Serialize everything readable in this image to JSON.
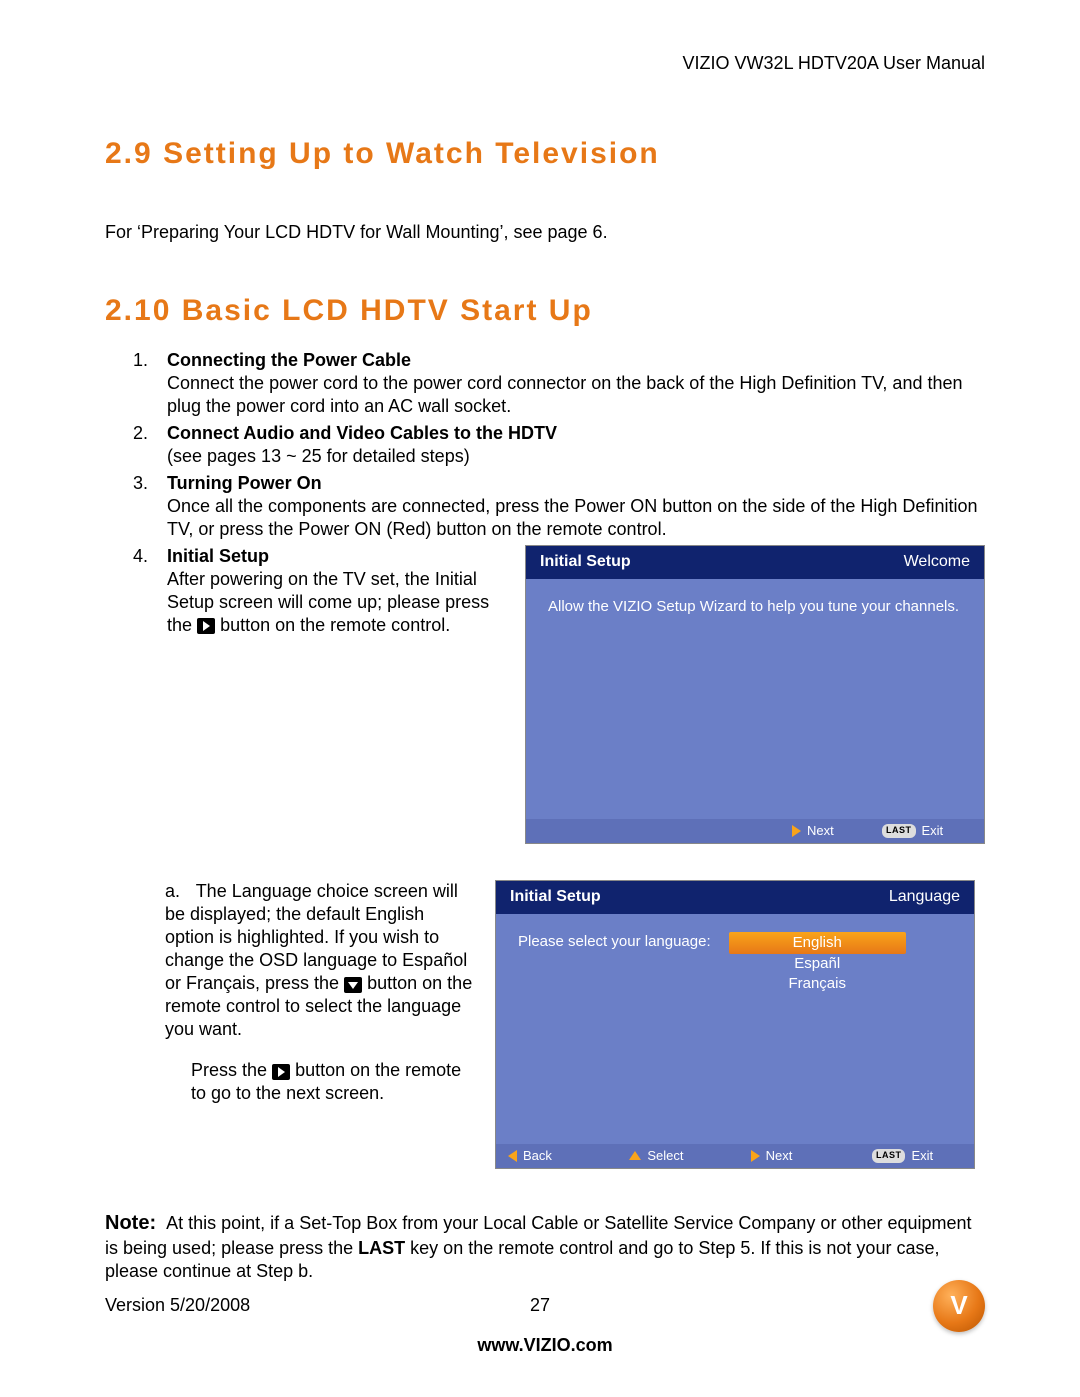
{
  "header": {
    "doc_title": "VIZIO VW32L HDTV20A User Manual"
  },
  "sec29": {
    "num": "2.9",
    "title": "Setting Up to Watch Television",
    "body": "For ‘Preparing Your LCD HDTV for Wall Mounting’, see page 6."
  },
  "sec210": {
    "num": "2.10",
    "title": "Basic LCD HDTV Start Up",
    "items": {
      "i1": {
        "head": "Connecting the Power Cable",
        "body": "Connect the power cord to the power cord connector on the back of the High Definition TV, and then plug the power cord into an AC wall socket."
      },
      "i2": {
        "head": "Connect Audio and Video Cables to the HDTV",
        "body": "(see pages 13 ~ 25 for detailed steps)"
      },
      "i3": {
        "head": "Turning Power On",
        "body": "Once all the components are connected, press the Power ON button on the side of the High Definition TV, or press the Power ON (Red) button on the remote control."
      },
      "i4": {
        "head": "Initial Setup",
        "body_a": "After powering on the TV set, the Initial Setup screen will come up; please press the",
        "body_b": "button on the remote control."
      }
    },
    "sub_a": {
      "label": "a.",
      "body_a": "The Language choice screen will be displayed; the default English option is highlighted.  If you wish to change the OSD language to Español or Français, press the",
      "body_b": "button on the remote control to select the language you want.",
      "body_c": "Press the",
      "body_d": "button on the remote to go to the next screen."
    }
  },
  "screens": {
    "s1": {
      "title_l": "Initial  Setup",
      "title_r": "Welcome",
      "body": "Allow the VIZIO Setup Wizard to help you tune your channels.",
      "foot_next": "Next",
      "foot_exit": "Exit",
      "foot_last": "LAST"
    },
    "s2": {
      "title_l": "Initial  Setup",
      "title_r": "Language",
      "prompt": "Please select your language:",
      "opts": {
        "o1": "English",
        "o2": "Españl",
        "o3": "Français"
      },
      "foot_back": "Back",
      "foot_select": "Select",
      "foot_next": "Next",
      "foot_exit": "Exit",
      "foot_last": "LAST"
    }
  },
  "note": {
    "label": "Note:",
    "body_a": "At this point, if a Set-Top Box from your Local Cable or Satellite Service Company or other equipment is being used; please press the ",
    "bold": "LAST",
    "body_b": " key on the remote control and go to Step 5. If this is not your case, please continue at Step b."
  },
  "footer": {
    "version": "Version 5/20/2008",
    "page": "27",
    "url": "www.VIZIO.com",
    "logo_letter": "V"
  }
}
